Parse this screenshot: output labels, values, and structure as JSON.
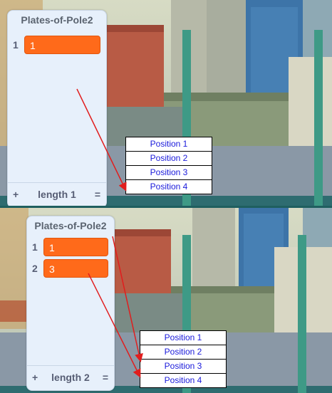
{
  "panel1": {
    "list_title": "Plates-of-Pole2",
    "items": [
      {
        "index": "1",
        "value": "1"
      }
    ],
    "add_label": "+",
    "length_label": "length 1",
    "resize_label": "=",
    "positions": [
      "Position 1",
      "Position 2",
      "Position 3",
      "Position 4"
    ]
  },
  "panel2": {
    "list_title": "Plates-of-Pole2",
    "items": [
      {
        "index": "1",
        "value": "1"
      },
      {
        "index": "2",
        "value": "3"
      }
    ],
    "add_label": "+",
    "length_label": "length 2",
    "resize_label": "=",
    "positions": [
      "Position 1",
      "Position 2",
      "Position 3",
      "Position 4"
    ]
  },
  "colors": {
    "item_fill": "#ff6a1a",
    "arrow": "#e11d1d",
    "position_text": "#1a1adb",
    "pole": "#3e9a86"
  }
}
